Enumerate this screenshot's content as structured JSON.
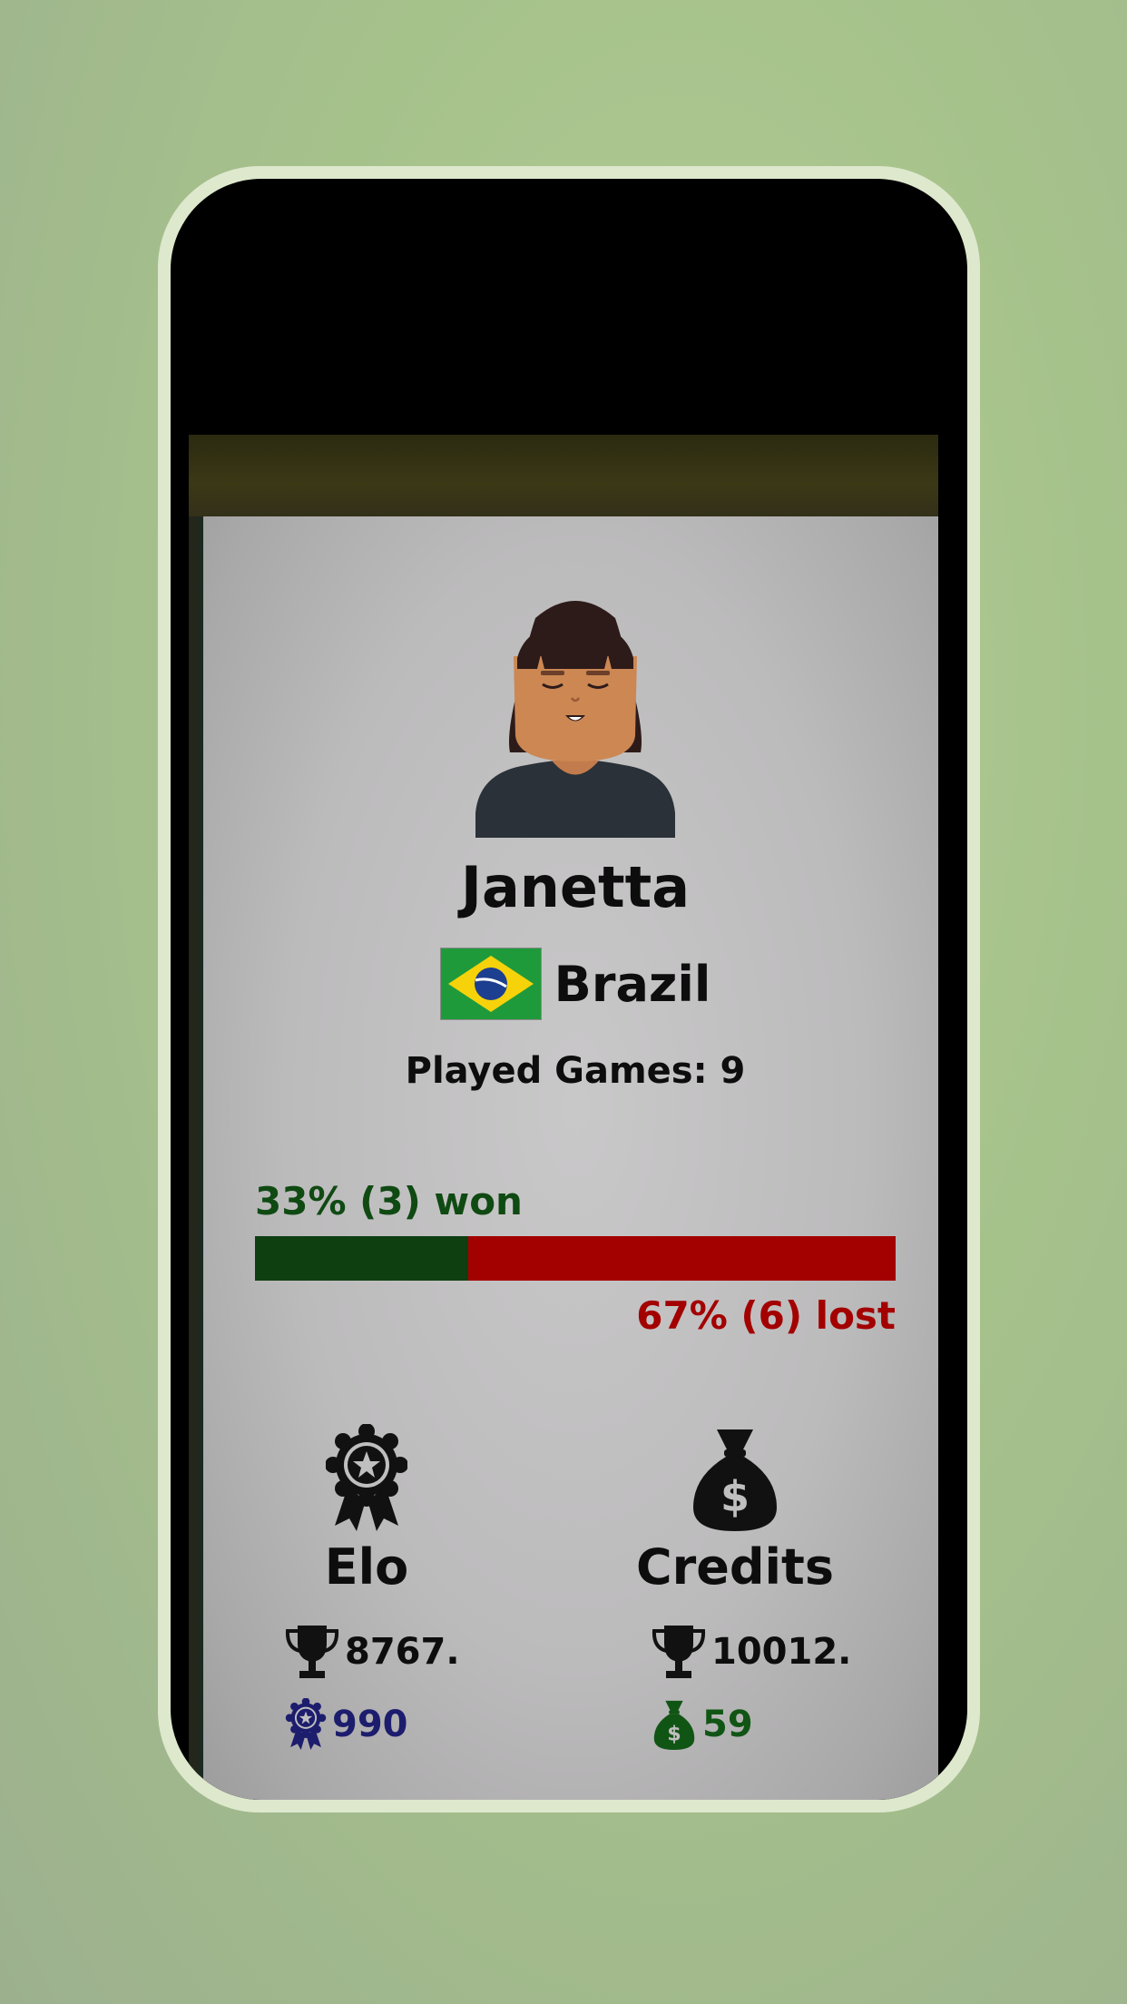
{
  "player": {
    "name": "Janetta",
    "country": "Brazil",
    "played_games": "Played Games: 9"
  },
  "record": {
    "won_label": "33% (3) won",
    "lost_label": "67% (6) lost",
    "won_fraction": 0.333
  },
  "elo": {
    "title": "Elo",
    "best": "8767.",
    "current": "990"
  },
  "credits": {
    "title": "Credits",
    "best": "10012.",
    "current": "59"
  },
  "colors": {
    "won": "#0d3f10",
    "lost": "#a30000",
    "elo_value": "#1d1d6e",
    "credits_value": "#115515"
  },
  "icons": [
    "avatar",
    "brazil-flag-icon",
    "award-medal-icon",
    "money-bag-icon",
    "trophy-icon"
  ]
}
